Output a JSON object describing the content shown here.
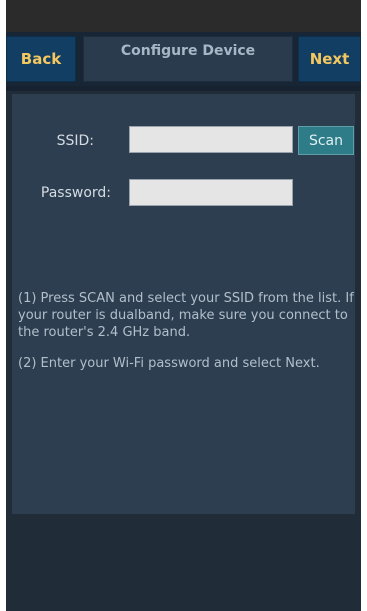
{
  "header": {
    "back_label": "Back",
    "title": "Configure Device",
    "next_label": "Next"
  },
  "form": {
    "ssid_label": "SSID:",
    "ssid_value": "",
    "scan_label": "Scan",
    "password_label": "Password:",
    "password_value": ""
  },
  "instructions": [
    "(1) Press SCAN and select your SSID from the list. If your router is dualband, make sure you connect to the router's 2.4 GHz band.",
    "(2) Enter your Wi-Fi password and select Next."
  ],
  "colors": {
    "accent_text": "#f4c860",
    "header_button": "#123e63",
    "scan_button": "#2e7c88",
    "panel": "#2d3e51"
  }
}
